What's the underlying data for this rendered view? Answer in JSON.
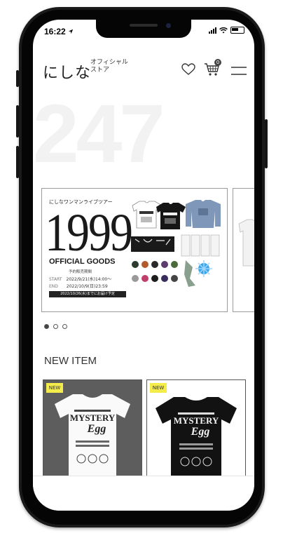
{
  "status": {
    "time": "16:22"
  },
  "header": {
    "logo_main": "にしな",
    "logo_sub_line1": "オフィシャル",
    "logo_sub_line2": "ストア",
    "cart_count": "0"
  },
  "hero_background_number": "247",
  "banner": {
    "tour_title": "にしなワンマンライブツアー",
    "big_number": "1999",
    "goods_title": "OFFICIAL GOODS",
    "presale_label": "予約販売期間",
    "start_label": "START",
    "start_value": "2022/9/21(水)14:00〜",
    "end_label": "END",
    "end_value": "2022/10/9(日)23:59",
    "delivery_note": "2022/10/26(水)までにお届け予定"
  },
  "carousel": {
    "count": 3,
    "active": 0
  },
  "new_item_section": {
    "title": "NEW ITEM",
    "items": [
      {
        "badge": "NEW",
        "shirt_title": "MYSTERY",
        "shirt_sub": "Egg",
        "color": "white"
      },
      {
        "badge": "NEW",
        "shirt_title": "MYSTERY",
        "shirt_sub": "Egg",
        "color": "black"
      }
    ]
  }
}
